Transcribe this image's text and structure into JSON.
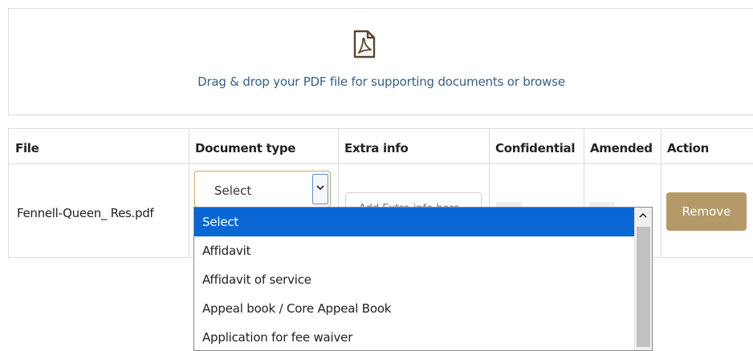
{
  "dropzone": {
    "icon": "pdf-file-icon",
    "text": "Drag & drop your PDF file for supporting documents or browse"
  },
  "table": {
    "headers": [
      "File",
      "Document type",
      "Extra info",
      "Confidential",
      "Amended",
      "Action"
    ],
    "row": {
      "file": "Fennell-Queen_ Res.pdf",
      "document_type": "Select",
      "extra_info_placeholder": "Add Extra info here",
      "action_label": "Remove"
    }
  },
  "dropdown": {
    "options": [
      "Select",
      "Affidavit",
      "Affidavit of service",
      "Appeal book / Core Appeal Book",
      "Application for fee waiver"
    ],
    "selected": "Select"
  },
  "colors": {
    "accent": "#b39a68",
    "selected_option": "#0a66d4",
    "link_text": "#3a5f80"
  }
}
